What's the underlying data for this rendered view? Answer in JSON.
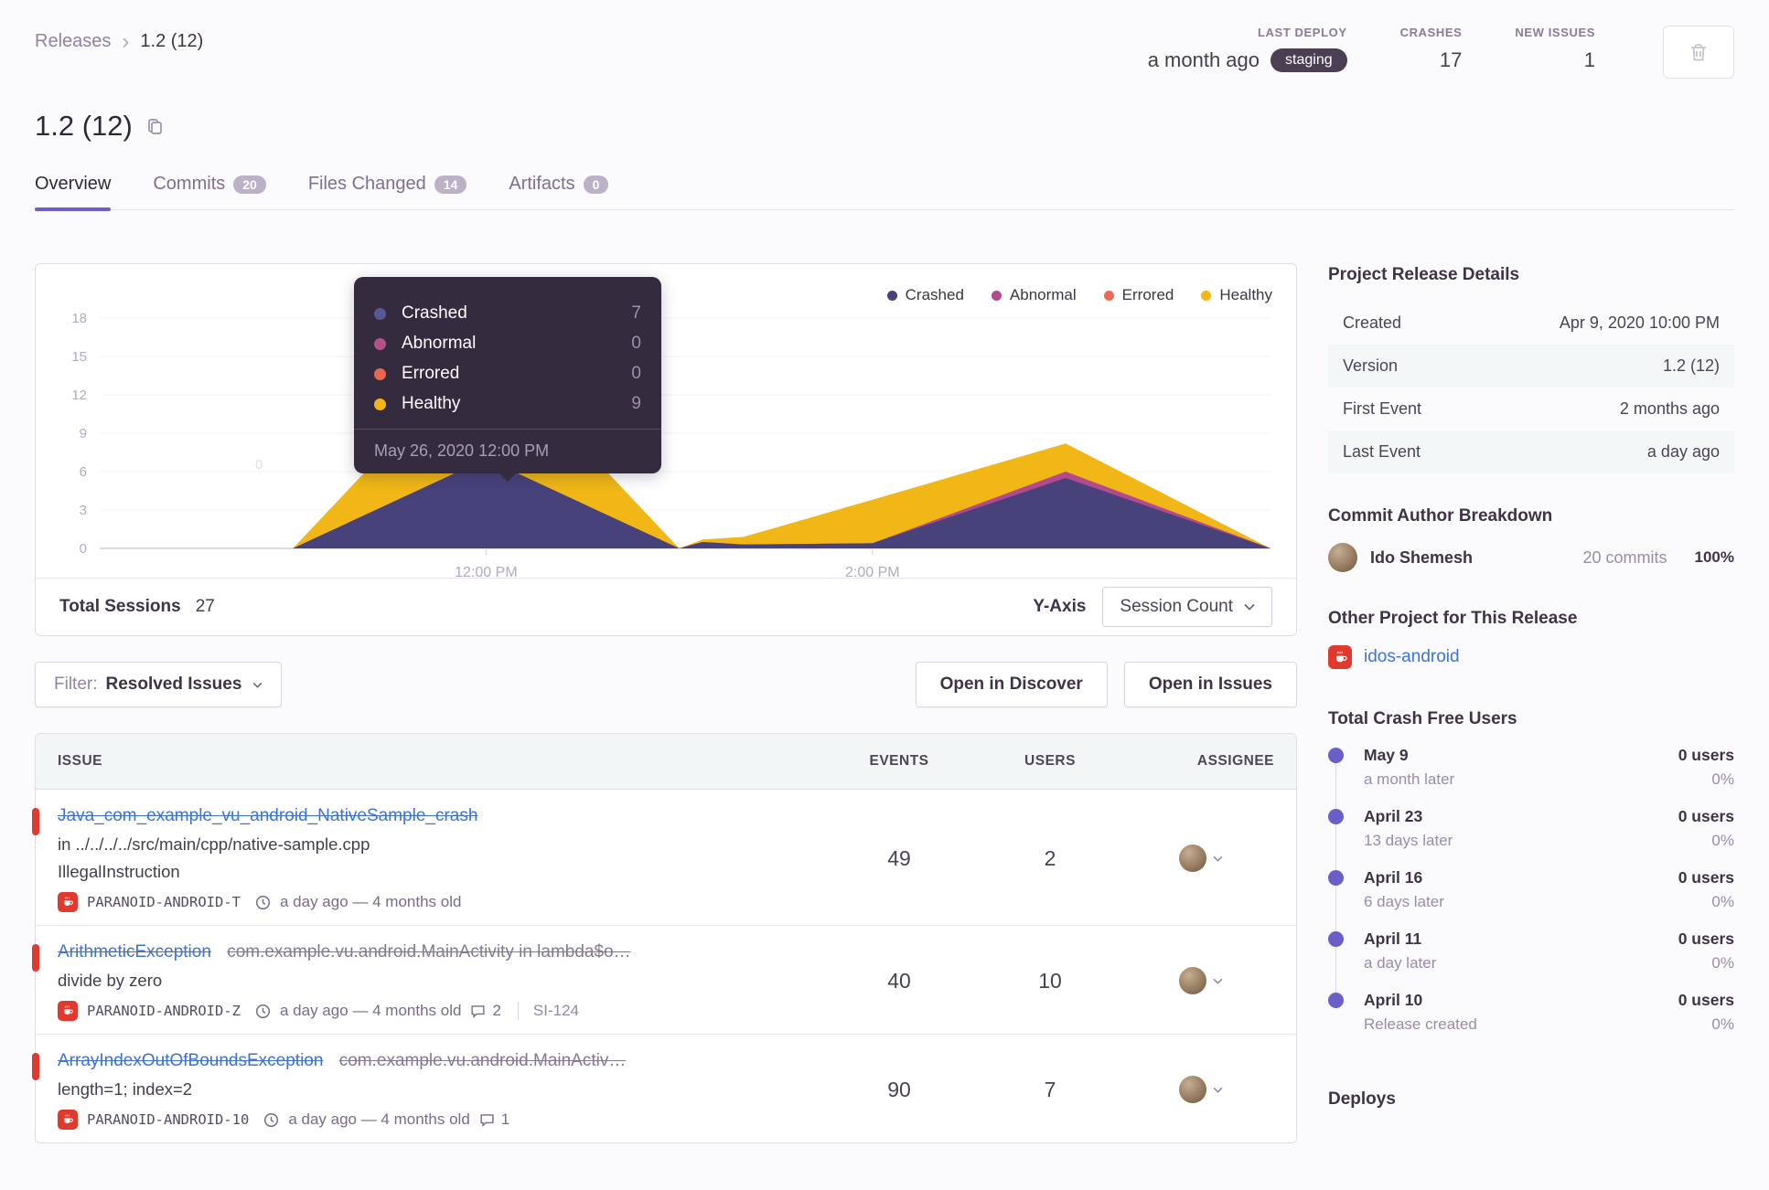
{
  "breadcrumb": {
    "parent": "Releases",
    "separator": "›",
    "current": "1.2 (12)"
  },
  "header_stats": {
    "last_deploy": {
      "label": "LAST DEPLOY",
      "value": "a month ago",
      "badge": "staging"
    },
    "crashes": {
      "label": "CRASHES",
      "value": "17"
    },
    "new_issues": {
      "label": "NEW ISSUES",
      "value": "1"
    }
  },
  "title": "1.2 (12)",
  "tabs": [
    {
      "label": "Overview",
      "count": "",
      "active": true
    },
    {
      "label": "Commits",
      "count": "20",
      "active": false
    },
    {
      "label": "Files Changed",
      "count": "14",
      "active": false
    },
    {
      "label": "Artifacts",
      "count": "0",
      "active": false
    }
  ],
  "chart_data": {
    "type": "area",
    "stacked": true,
    "legend_position": "top-right",
    "x_axis": {
      "tick_labels": [
        "12:00 PM",
        "2:00 PM"
      ],
      "tick_fractions": [
        0.33,
        0.66
      ]
    },
    "y_axis": {
      "ticks": [
        0,
        3,
        6,
        9,
        12,
        15,
        18
      ],
      "lim": [
        0,
        18
      ]
    },
    "series": [
      {
        "name": "Crashed",
        "key": "crashed",
        "color": "#47427a"
      },
      {
        "name": "Abnormal",
        "key": "abnormal",
        "color": "#b34a8f"
      },
      {
        "name": "Errored",
        "key": "errored",
        "color": "#ea6a55"
      },
      {
        "name": "Healthy",
        "key": "healthy",
        "color": "#f0b716"
      }
    ],
    "points": [
      {
        "f": 0.165,
        "crashed": 0,
        "abnormal": 0,
        "errored": 0,
        "healthy": 0
      },
      {
        "f": 0.33,
        "crashed": 7,
        "abnormal": 0,
        "errored": 0,
        "healthy": 9
      },
      {
        "f": 0.495,
        "crashed": 0,
        "abnormal": 0,
        "errored": 0,
        "healthy": 0
      },
      {
        "f": 0.515,
        "crashed": 0.5,
        "abnormal": 0,
        "errored": 0,
        "healthy": 0.2
      },
      {
        "f": 0.55,
        "crashed": 0.3,
        "abnormal": 0,
        "errored": 0,
        "healthy": 0.6
      },
      {
        "f": 0.66,
        "crashed": 0.4,
        "abnormal": 0,
        "errored": 0,
        "healthy": 3.4
      },
      {
        "f": 0.825,
        "crashed": 5.5,
        "abnormal": 0.5,
        "errored": 0,
        "healthy": 2.2
      },
      {
        "f": 1,
        "crashed": 0,
        "abnormal": 0,
        "errored": 0,
        "healthy": 0
      }
    ],
    "ghost_label": "0",
    "tooltip": {
      "date": "May 26, 2020 12:00 PM",
      "rows": [
        {
          "label": "Crashed",
          "value": "7",
          "color": "#5a5796"
        },
        {
          "label": "Abnormal",
          "value": "0",
          "color": "#b5508c"
        },
        {
          "label": "Errored",
          "value": "0",
          "color": "#e8684f"
        },
        {
          "label": "Healthy",
          "value": "9",
          "color": "#f0b716"
        }
      ]
    },
    "footer": {
      "total_label": "Total Sessions",
      "total_value": "27",
      "yaxis_label": "Y-Axis",
      "yaxis_value": "Session Count"
    }
  },
  "filter": {
    "label": "Filter:",
    "value": "Resolved Issues"
  },
  "actions": {
    "discover": "Open in Discover",
    "issues": "Open in Issues"
  },
  "issues_table": {
    "columns": [
      "ISSUE",
      "EVENTS",
      "USERS",
      "ASSIGNEE"
    ],
    "rows": [
      {
        "title": "Java_com_example_vu_android_NativeSample_crash",
        "subtitle": "",
        "location": "in ../../../../src/main/cpp/native-sample.cpp",
        "extra": "IllegalInstruction",
        "project": "PARANOID-ANDROID-T",
        "age": "a day ago — 4 months old",
        "comments": "",
        "ticket": "",
        "events": "49",
        "users": "2"
      },
      {
        "title": "ArithmeticException",
        "subtitle": "com.example.vu.android.MainActivity in lambda$o…",
        "location": "divide by zero",
        "extra": "",
        "project": "PARANOID-ANDROID-Z",
        "age": "a day ago — 4 months old",
        "comments": "2",
        "ticket": "SI-124",
        "events": "40",
        "users": "10"
      },
      {
        "title": "ArrayIndexOutOfBoundsException",
        "subtitle": "com.example.vu.android.MainActiv…",
        "location": "length=1; index=2",
        "extra": "",
        "project": "PARANOID-ANDROID-10",
        "age": "a day ago — 4 months old",
        "comments": "1",
        "ticket": "",
        "events": "90",
        "users": "7"
      }
    ]
  },
  "sidebar": {
    "release_details": {
      "heading": "Project Release Details",
      "rows": [
        {
          "label": "Created",
          "value": "Apr 9, 2020 10:00 PM"
        },
        {
          "label": "Version",
          "value": "1.2 (12)"
        },
        {
          "label": "First Event",
          "value": "2 months ago"
        },
        {
          "label": "Last Event",
          "value": "a day ago"
        }
      ]
    },
    "commit_authors": {
      "heading": "Commit Author Breakdown",
      "author": "Ido Shemesh",
      "commits": "20 commits",
      "percent": "100%"
    },
    "other_project": {
      "heading": "Other Project for This Release",
      "project": "idos-android"
    },
    "crash_free": {
      "heading": "Total Crash Free Users",
      "entries": [
        {
          "date": "May 9",
          "sub": "a month later",
          "users": "0 users",
          "pct": "0%"
        },
        {
          "date": "April 23",
          "sub": "13 days later",
          "users": "0 users",
          "pct": "0%"
        },
        {
          "date": "April 16",
          "sub": "6 days later",
          "users": "0 users",
          "pct": "0%"
        },
        {
          "date": "April 11",
          "sub": "a day later",
          "users": "0 users",
          "pct": "0%"
        },
        {
          "date": "April 10",
          "sub": "Release created",
          "users": "0 users",
          "pct": "0%"
        }
      ]
    },
    "deploys_heading": "Deploys"
  },
  "icons": {
    "breadcrumb-separator": "›",
    "trash": "trash-can outline",
    "copy": "two overlapping squares",
    "chevron-down": "v chevron",
    "clock": "circle with hands",
    "comment": "speech bubble",
    "java-project": "white coffee cup on red square"
  },
  "colors": {
    "accent_purple": "#6c5fc7",
    "link_blue": "#3f72d1",
    "level_red": "#e0392e",
    "staging_bg": "#4a3f55",
    "timeline_dot": "#6a5fc8"
  }
}
